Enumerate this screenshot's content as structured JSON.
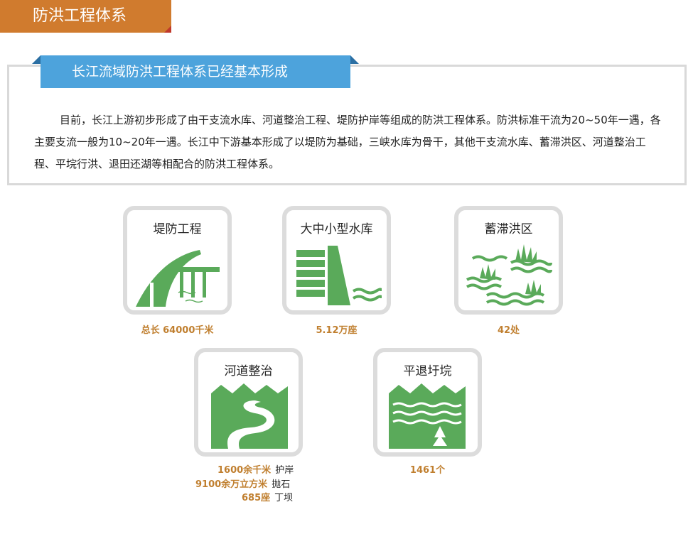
{
  "header": {
    "title": "防洪工程体系"
  },
  "intro": {
    "banner": "长江流域防洪工程体系已经基本形成",
    "text": "目前，长江上游初步形成了由干支流水库、河道整治工程、堤防护岸等组成的防洪工程体系。防洪标准干流为20~50年一遇，各主要支流一般为10~20年一遇。长江中下游基本形成了以堤防为基础，三峡水库为骨干，其他干支流水库、蓄滞洪区、河道整治工程、平垸行洪、退田还湖等相配合的防洪工程体系。"
  },
  "cards": {
    "levee": {
      "title": "堤防工程",
      "stat": "总长 64000千米",
      "icon": "levee-icon"
    },
    "reservoir": {
      "title": "大中小型水库",
      "stat": "5.12万座",
      "icon": "dam-icon"
    },
    "detention": {
      "title": "蓄滞洪区",
      "stat": "42处",
      "icon": "wetland-icon"
    },
    "river": {
      "title": "河道整治",
      "icon": "river-icon",
      "rows": [
        {
          "num": "1600余千米",
          "unit": "护岸"
        },
        {
          "num": "9100余万立方米",
          "unit": "抛石"
        },
        {
          "num": "685座",
          "unit": "丁坝"
        }
      ]
    },
    "polder": {
      "title": "平退圩垸",
      "stat": "1461个",
      "icon": "polder-icon"
    }
  },
  "colors": {
    "accent_orange": "#d07b2e",
    "banner_blue": "#4da3dc",
    "icon_green": "#5aaa5a",
    "stat_gold": "#c07f2f"
  }
}
